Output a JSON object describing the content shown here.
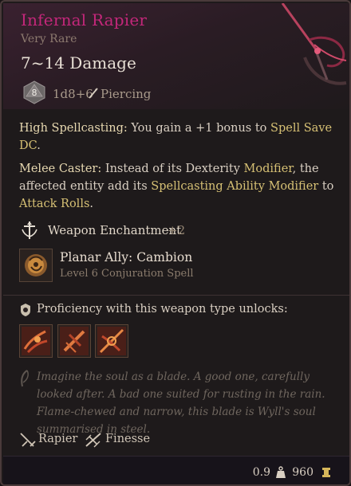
{
  "item": {
    "name": "Infernal Rapier",
    "rarity": "Very Rare",
    "damage": "7~14 Damage",
    "dice_face": "8",
    "damage_roll": "1d8+6",
    "damage_type": "Piercing"
  },
  "passives": [
    {
      "title": "High Spellcasting:",
      "text_parts": [
        "You gain a +1 bonus to ",
        "Spell Save DC",
        "."
      ]
    },
    {
      "title": "Melee Caster:",
      "text_parts": [
        "Instead of its Dexterity ",
        "Modifier",
        ", the affected entity add its ",
        "Spellcasting Ability Modifier",
        " to ",
        "Attack Rolls",
        "."
      ]
    }
  ],
  "enchantment": {
    "label": "Weapon Enchantment",
    "bonus": "+2"
  },
  "spell": {
    "name": "Planar Ally: Cambion",
    "level": "Level 6 Conjuration Spell"
  },
  "proficiency": {
    "label": "Proficiency with this weapon type unlocks:"
  },
  "lore": "Imagine the soul as a blade. A good one, carefully looked after. A bad one suited for rusting in the rain. Flame-chewed and narrow, this blade is Wyll's soul summarised in steel.",
  "properties": [
    {
      "label": "Rapier",
      "icon": "rapier-icon"
    },
    {
      "label": "Finesse",
      "icon": "finesse-icon"
    }
  ],
  "footer": {
    "weight": "0.9",
    "price": "960"
  },
  "colors": {
    "name": "#c3277a",
    "keyword": "#d6c074",
    "lore": "#6f665e"
  }
}
